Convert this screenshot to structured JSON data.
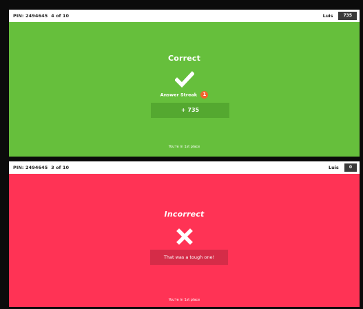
{
  "correct_screen": {
    "pin_text": "PIN: 2494645",
    "progress_text": "4 of 10",
    "player_name": "Luis",
    "score": "735",
    "result_title": "Correct",
    "streak_label": "Answer Streak",
    "streak_count": "1",
    "points_text": "+ 735",
    "place_text": "You're in 1st place",
    "background_color": "#66bf3c"
  },
  "incorrect_screen": {
    "pin_text": "PIN: 2494645",
    "progress_text": "3 of 10",
    "player_name": "Luis",
    "score": "0",
    "result_title": "Incorrect",
    "message_text": "That was a tough one!",
    "place_text": "You're in 1st place",
    "background_color": "#ff3355"
  },
  "icons": {
    "correct": "checkmark-icon",
    "incorrect": "cross-icon",
    "streak": "flame-icon"
  }
}
